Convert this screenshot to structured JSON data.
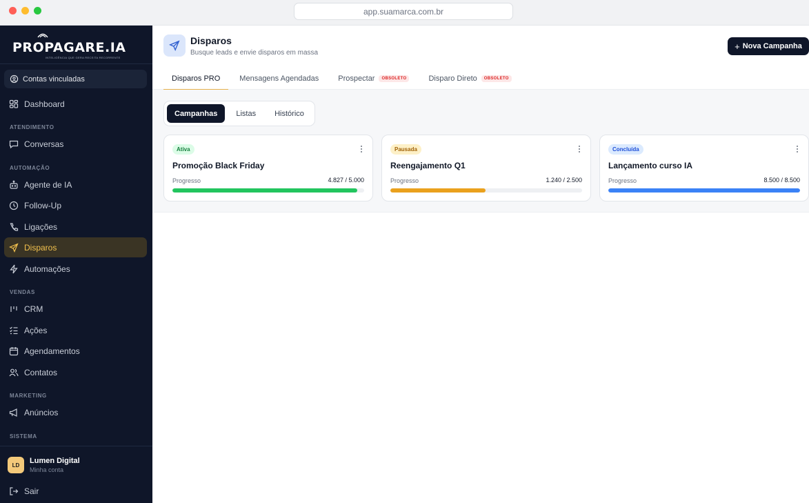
{
  "browser": {
    "url": "app.suamarca.com.br"
  },
  "sidebar": {
    "logo": {
      "text": "PROPAGARE.IA",
      "tagline": "INTELIGÊNCIA QUE GERA RECEITA RECORRENTE"
    },
    "accounts_label": "Contas vinculadas",
    "dashboard": "Dashboard",
    "sections": {
      "atendimento": "ATENDIMENTO",
      "automacao": "AUTOMAÇÃO",
      "vendas": "VENDAS",
      "marketing": "MARKETING",
      "sistema": "SISTEMA"
    },
    "items": {
      "conversas": "Conversas",
      "agente": "Agente de IA",
      "followup": "Follow-Up",
      "ligacoes": "Ligações",
      "disparos": "Disparos",
      "automacoes": "Automações",
      "crm": "CRM",
      "acoes": "Ações",
      "agendamentos": "Agendamentos",
      "contatos": "Contatos",
      "anuncios": "Anúncios"
    },
    "user": {
      "initials": "LD",
      "name": "Lumen Digital",
      "subtitle": "Minha conta"
    },
    "logout": "Sair",
    "colors": {
      "background": "#0f1629",
      "active": "#f2c14e"
    }
  },
  "header": {
    "title": "Disparos",
    "subtitle": "Busque leads e envie disparos em massa",
    "new_button": "Nova Campanha",
    "tabs": [
      {
        "label": "Disparos PRO",
        "badge": ""
      },
      {
        "label": "Mensagens Agendadas",
        "badge": ""
      },
      {
        "label": "Prospectar",
        "badge": "OBSOLETO"
      },
      {
        "label": "Disparo Direto",
        "badge": "OBSOLETO"
      }
    ]
  },
  "segment": {
    "options": [
      "Campanhas",
      "Listas",
      "Histórico"
    ],
    "selected": "Campanhas"
  },
  "campaigns": [
    {
      "status": "Ativa",
      "title": "Promoção Black Friday",
      "progress_label": "Progresso",
      "progress_text": "4.827 / 5.000",
      "progress": 0.9654,
      "color": "#22c55e",
      "badge_bg": "#dcfce7",
      "badge_fg": "#15803d"
    },
    {
      "status": "Pausada",
      "title": "Reengajamento Q1",
      "progress_label": "Progresso",
      "progress_text": "1.240 / 2.500",
      "progress": 0.496,
      "color": "#eaa11d",
      "badge_bg": "#fdf0c7",
      "badge_fg": "#a16207"
    },
    {
      "status": "Concluída",
      "title": "Lançamento curso IA",
      "progress_label": "Progresso",
      "progress_text": "8.500 / 8.500",
      "progress": 1.0,
      "color": "#3b82f6",
      "badge_bg": "#dbeafe",
      "badge_fg": "#1d4ed8"
    }
  ]
}
